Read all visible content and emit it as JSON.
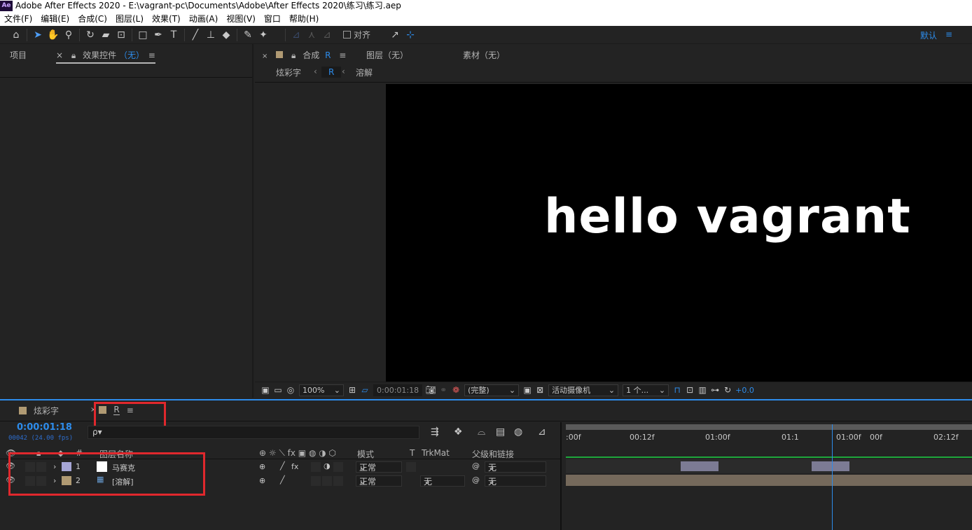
{
  "window": {
    "title": "Adobe After Effects 2020 - E:\\vagrant-pc\\Documents\\Adobe\\After Effects 2020\\练习\\练习.aep",
    "logo": "Ae"
  },
  "menu": [
    "文件(F)",
    "编辑(E)",
    "合成(C)",
    "图层(L)",
    "效果(T)",
    "动画(A)",
    "视图(V)",
    "窗口",
    "帮助(H)"
  ],
  "toolbar": {
    "snap_label": "对齐",
    "workspace": "默认"
  },
  "left_panel": {
    "project_tab": "项目",
    "effects_tab": "效果控件",
    "effects_none": "（无）"
  },
  "comp_panel": {
    "comp_tab_label": "合成",
    "comp_tab_name": "R",
    "layer_tab": "图层（无）",
    "footage_tab": "素材（无）",
    "crumbs": {
      "parent": "炫彩字",
      "current": "R",
      "child": "溶解"
    },
    "viewer_text": "hello vagrant",
    "zoom": "100%",
    "timecode": "0:00:01:18",
    "resolution": "(完整)",
    "camera": "活动摄像机",
    "views": "1 个...",
    "exposure": "+0.0"
  },
  "timeline": {
    "tabs": [
      {
        "label": "炫彩字",
        "color": "#b09a73"
      },
      {
        "label": "R",
        "color": "#b09a73"
      }
    ],
    "timecode": "0:00:01:18",
    "frames": "00042 (24.00 fps)",
    "search_placeholder": "ρ▾",
    "columns": {
      "label_num": "#",
      "layer_name": "图层名称",
      "mode": "模式",
      "t": "T",
      "trkmat": "TrkMat",
      "parent": "父级和链接"
    },
    "layers": [
      {
        "num": "1",
        "name": "马赛克",
        "mode": "正常",
        "trkmat": "",
        "parent": "无",
        "label_color": "#a6a6d6",
        "thumb": "white"
      },
      {
        "num": "2",
        "name": "[溶解]",
        "mode": "正常",
        "trkmat": "无",
        "parent": "无",
        "label_color": "#b09a73",
        "thumb": "comp"
      }
    ],
    "ruler_labels": [
      ":00f",
      "00:12f",
      "01:00f",
      "01:1",
      "01:00f",
      "00f",
      "02:12f"
    ]
  }
}
